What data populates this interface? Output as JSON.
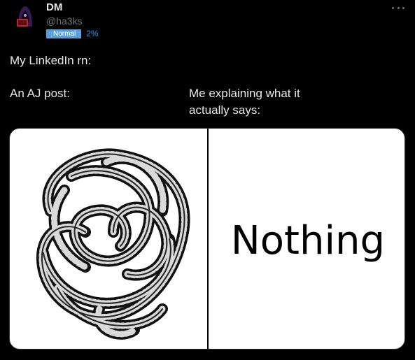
{
  "author": {
    "name": "DM",
    "handle": "@ha3ks",
    "badge": "Normal",
    "percent": "2%"
  },
  "post": {
    "line1": "My LinkedIn rn:",
    "left_caption": "An AJ post:",
    "right_caption": "Me explaining what it actually says:"
  },
  "meme": {
    "left_image": "tangled-rope-drawing",
    "right_text": "Nothing"
  },
  "icons": {
    "more": "more-options-icon",
    "avatar": "hacker-hoodie-avatar"
  },
  "colors": {
    "background": "#000000",
    "text": "#e7e9ea",
    "muted": "#71767b",
    "badge": "#5b9fd9",
    "accent": "#1d9bf0"
  }
}
